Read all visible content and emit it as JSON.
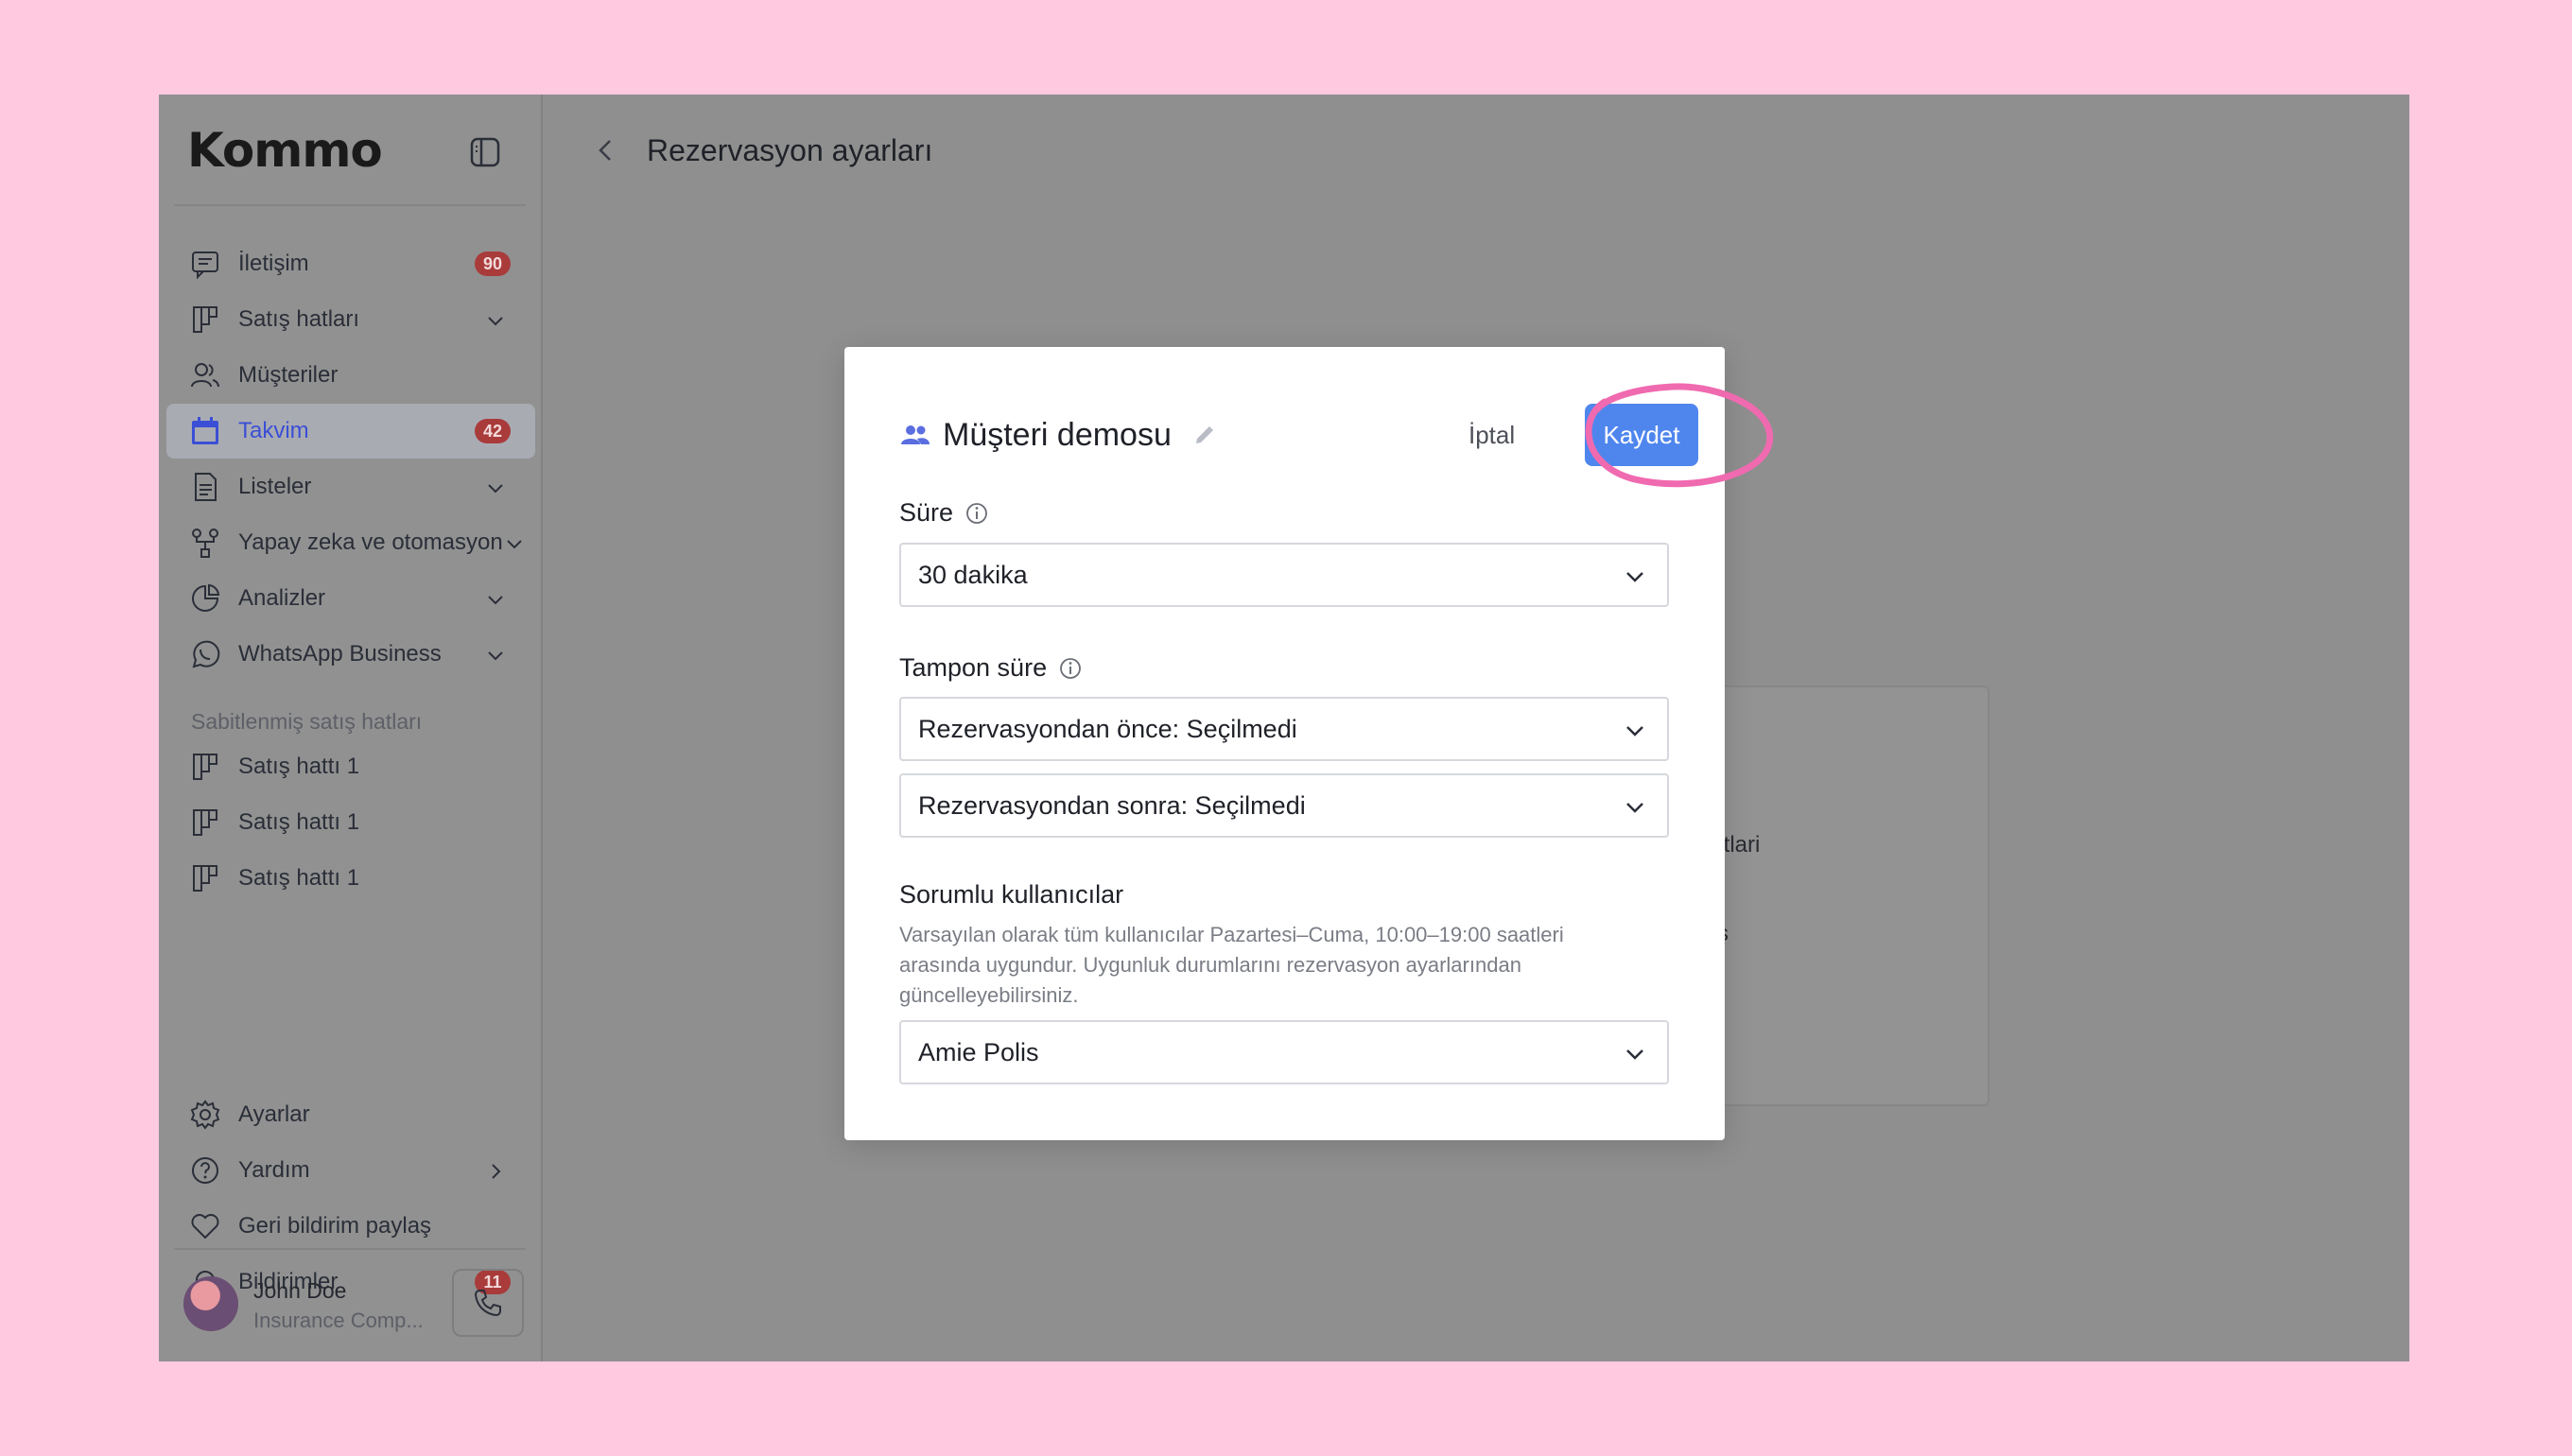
{
  "app": {
    "logo": "Kommo"
  },
  "sidebar": {
    "items": [
      {
        "label": "İletişim",
        "icon": "chat-icon",
        "badge": "90"
      },
      {
        "label": "Satış hatları",
        "icon": "pipeline-icon",
        "chevron": true
      },
      {
        "label": "Müşteriler",
        "icon": "users-icon"
      },
      {
        "label": "Takvim",
        "icon": "calendar-icon",
        "badge": "42",
        "active": true
      },
      {
        "label": "Listeler",
        "icon": "list-icon",
        "chevron": true
      },
      {
        "label": "Yapay zeka ve otomasyon",
        "icon": "automation-icon",
        "chevron": true
      },
      {
        "label": "Analizler",
        "icon": "analytics-icon",
        "chevron": true
      },
      {
        "label": "WhatsApp Business",
        "icon": "whatsapp-icon",
        "chevron": true
      }
    ],
    "pinned_title": "Sabitlenmiş satış hatları",
    "pinned": [
      {
        "label": "Satış hattı 1"
      },
      {
        "label": "Satış hattı 1"
      },
      {
        "label": "Satış hattı 1"
      }
    ],
    "bottom": [
      {
        "label": "Ayarlar",
        "icon": "gear-icon"
      },
      {
        "label": "Yardım",
        "icon": "help-icon",
        "chevron": true
      },
      {
        "label": "Geri bildirim paylaş",
        "icon": "heart-icon"
      },
      {
        "label": "Bildirimler",
        "icon": "bell-icon",
        "badge": "11"
      }
    ],
    "user": {
      "name": "John Doe",
      "company": "Insurance Comp..."
    }
  },
  "header": {
    "title": "Rezervasyon ayarları"
  },
  "background": {
    "text1": "ıtlari",
    "text2": "ş"
  },
  "modal": {
    "title": "Müşteri demosu",
    "cancel_label": "İptal",
    "save_label": "Kaydet",
    "duration": {
      "label": "Süre",
      "value": "30 dakika"
    },
    "buffer": {
      "label": "Tampon süre",
      "before": "Rezervasyondan önce: Seçilmedi",
      "after": "Rezervasyondan sonra: Seçilmedi"
    },
    "responsible": {
      "label": "Sorumlu kullanıcılar",
      "help": "Varsayılan olarak tüm kullanıcılar Pazartesi–Cuma, 10:00–19:00 saatleri arasında uygundur. Uygunluk durumlarını rezervasyon ayarlarından güncelleyebilirsiniz.",
      "value": "Amie Polis"
    }
  },
  "colors": {
    "accent": "#4f86ee",
    "active_nav": "#3a4fd6",
    "badge": "#a93b3b",
    "highlight": "#f06ab0",
    "page_bg": "#ffc9e0"
  }
}
